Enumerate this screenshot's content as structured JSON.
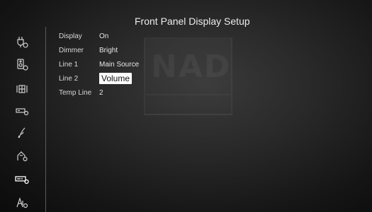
{
  "header": {
    "title": "Front Panel Display Setup"
  },
  "sidebar": {
    "icons": [
      "input-setup-icon",
      "speaker-setup-icon",
      "listening-mode-icon",
      "display-icon",
      "tone-icon",
      "zone-icon",
      "front-panel-display-icon",
      "amp-icon"
    ],
    "selected_index": 6
  },
  "settings": {
    "rows": [
      {
        "label": "Display",
        "value": "On"
      },
      {
        "label": "Dimmer",
        "value": "Bright"
      },
      {
        "label": "Line 1",
        "value": "Main Source"
      },
      {
        "label": "Line 2",
        "value": "Volume"
      },
      {
        "label": "Temp Line",
        "value": "2"
      }
    ],
    "selected_row": 3
  },
  "watermark": {
    "text": "NAD"
  },
  "colors": {
    "background": "#1e1e1e",
    "selected_bg": "#ffffff",
    "text": "#e8e8e8"
  }
}
